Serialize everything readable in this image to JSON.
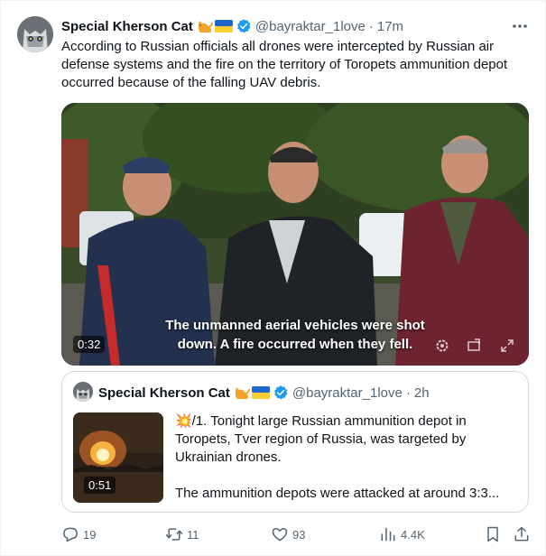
{
  "tweet": {
    "author_name": "Special Kherson Cat",
    "handle": "@bayraktar_1love",
    "separator": "·",
    "time": "17m",
    "text": "According to Russian officials all drones were intercepted by Russian air defense systems and the fire on the territory of Toropets ammunition depot occurred because of the falling UAV debris.",
    "name_emojis": [
      "cat-icon",
      "ukraine-flag-icon"
    ],
    "video": {
      "caption_line1": "The unmanned aerial vehicles were shot",
      "caption_line2": "down. A fire occurred when they fell.",
      "duration": "0:32"
    }
  },
  "quote": {
    "author_name": "Special Kherson Cat",
    "handle": "@bayraktar_1love",
    "separator": "·",
    "time": "2h",
    "line1": "💥/1. Tonight large Russian ammunition depot in Toropets, Tver region of Russia, was targeted by Ukrainian drones.",
    "line2": "The ammunition depots were attacked at around 3:3...",
    "video_duration": "0:51"
  },
  "actions": {
    "replies": "19",
    "reposts": "11",
    "likes": "93",
    "views": "4.4K"
  },
  "colors": {
    "verified": "#1d9bf0",
    "secondary_text": "#536471",
    "border": "#cfd9de"
  }
}
